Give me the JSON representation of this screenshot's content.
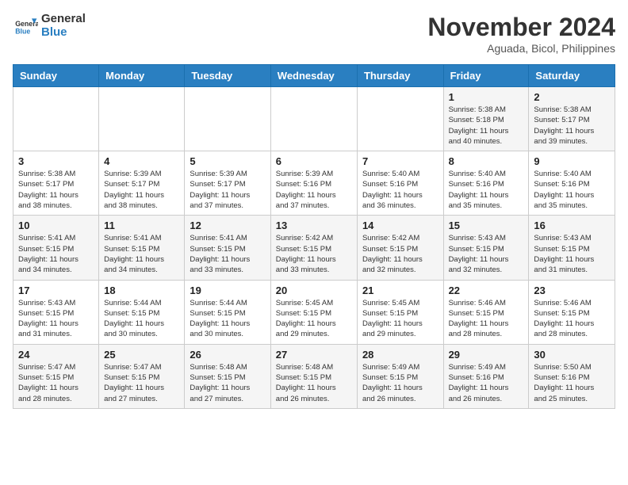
{
  "header": {
    "logo_line1": "General",
    "logo_line2": "Blue",
    "month_year": "November 2024",
    "location": "Aguada, Bicol, Philippines"
  },
  "weekdays": [
    "Sunday",
    "Monday",
    "Tuesday",
    "Wednesday",
    "Thursday",
    "Friday",
    "Saturday"
  ],
  "weeks": [
    [
      {
        "day": "",
        "info": ""
      },
      {
        "day": "",
        "info": ""
      },
      {
        "day": "",
        "info": ""
      },
      {
        "day": "",
        "info": ""
      },
      {
        "day": "",
        "info": ""
      },
      {
        "day": "1",
        "info": "Sunrise: 5:38 AM\nSunset: 5:18 PM\nDaylight: 11 hours\nand 40 minutes."
      },
      {
        "day": "2",
        "info": "Sunrise: 5:38 AM\nSunset: 5:17 PM\nDaylight: 11 hours\nand 39 minutes."
      }
    ],
    [
      {
        "day": "3",
        "info": "Sunrise: 5:38 AM\nSunset: 5:17 PM\nDaylight: 11 hours\nand 38 minutes."
      },
      {
        "day": "4",
        "info": "Sunrise: 5:39 AM\nSunset: 5:17 PM\nDaylight: 11 hours\nand 38 minutes."
      },
      {
        "day": "5",
        "info": "Sunrise: 5:39 AM\nSunset: 5:17 PM\nDaylight: 11 hours\nand 37 minutes."
      },
      {
        "day": "6",
        "info": "Sunrise: 5:39 AM\nSunset: 5:16 PM\nDaylight: 11 hours\nand 37 minutes."
      },
      {
        "day": "7",
        "info": "Sunrise: 5:40 AM\nSunset: 5:16 PM\nDaylight: 11 hours\nand 36 minutes."
      },
      {
        "day": "8",
        "info": "Sunrise: 5:40 AM\nSunset: 5:16 PM\nDaylight: 11 hours\nand 35 minutes."
      },
      {
        "day": "9",
        "info": "Sunrise: 5:40 AM\nSunset: 5:16 PM\nDaylight: 11 hours\nand 35 minutes."
      }
    ],
    [
      {
        "day": "10",
        "info": "Sunrise: 5:41 AM\nSunset: 5:15 PM\nDaylight: 11 hours\nand 34 minutes."
      },
      {
        "day": "11",
        "info": "Sunrise: 5:41 AM\nSunset: 5:15 PM\nDaylight: 11 hours\nand 34 minutes."
      },
      {
        "day": "12",
        "info": "Sunrise: 5:41 AM\nSunset: 5:15 PM\nDaylight: 11 hours\nand 33 minutes."
      },
      {
        "day": "13",
        "info": "Sunrise: 5:42 AM\nSunset: 5:15 PM\nDaylight: 11 hours\nand 33 minutes."
      },
      {
        "day": "14",
        "info": "Sunrise: 5:42 AM\nSunset: 5:15 PM\nDaylight: 11 hours\nand 32 minutes."
      },
      {
        "day": "15",
        "info": "Sunrise: 5:43 AM\nSunset: 5:15 PM\nDaylight: 11 hours\nand 32 minutes."
      },
      {
        "day": "16",
        "info": "Sunrise: 5:43 AM\nSunset: 5:15 PM\nDaylight: 11 hours\nand 31 minutes."
      }
    ],
    [
      {
        "day": "17",
        "info": "Sunrise: 5:43 AM\nSunset: 5:15 PM\nDaylight: 11 hours\nand 31 minutes."
      },
      {
        "day": "18",
        "info": "Sunrise: 5:44 AM\nSunset: 5:15 PM\nDaylight: 11 hours\nand 30 minutes."
      },
      {
        "day": "19",
        "info": "Sunrise: 5:44 AM\nSunset: 5:15 PM\nDaylight: 11 hours\nand 30 minutes."
      },
      {
        "day": "20",
        "info": "Sunrise: 5:45 AM\nSunset: 5:15 PM\nDaylight: 11 hours\nand 29 minutes."
      },
      {
        "day": "21",
        "info": "Sunrise: 5:45 AM\nSunset: 5:15 PM\nDaylight: 11 hours\nand 29 minutes."
      },
      {
        "day": "22",
        "info": "Sunrise: 5:46 AM\nSunset: 5:15 PM\nDaylight: 11 hours\nand 28 minutes."
      },
      {
        "day": "23",
        "info": "Sunrise: 5:46 AM\nSunset: 5:15 PM\nDaylight: 11 hours\nand 28 minutes."
      }
    ],
    [
      {
        "day": "24",
        "info": "Sunrise: 5:47 AM\nSunset: 5:15 PM\nDaylight: 11 hours\nand 28 minutes."
      },
      {
        "day": "25",
        "info": "Sunrise: 5:47 AM\nSunset: 5:15 PM\nDaylight: 11 hours\nand 27 minutes."
      },
      {
        "day": "26",
        "info": "Sunrise: 5:48 AM\nSunset: 5:15 PM\nDaylight: 11 hours\nand 27 minutes."
      },
      {
        "day": "27",
        "info": "Sunrise: 5:48 AM\nSunset: 5:15 PM\nDaylight: 11 hours\nand 26 minutes."
      },
      {
        "day": "28",
        "info": "Sunrise: 5:49 AM\nSunset: 5:15 PM\nDaylight: 11 hours\nand 26 minutes."
      },
      {
        "day": "29",
        "info": "Sunrise: 5:49 AM\nSunset: 5:16 PM\nDaylight: 11 hours\nand 26 minutes."
      },
      {
        "day": "30",
        "info": "Sunrise: 5:50 AM\nSunset: 5:16 PM\nDaylight: 11 hours\nand 25 minutes."
      }
    ]
  ]
}
